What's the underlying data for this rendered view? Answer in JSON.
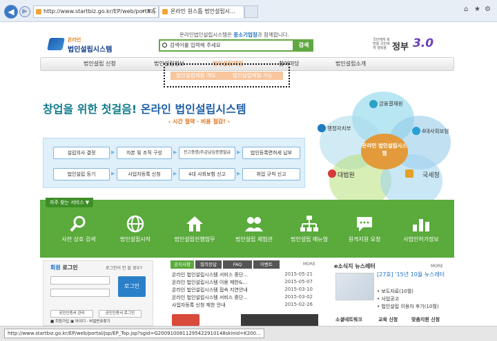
{
  "browser": {
    "address": "http://www.startbiz.go.kr/EP/web/portal/j",
    "tab_title": "온라인 원스톱 법인설립시...",
    "address_controls": "⌕ ▾ C"
  },
  "logo": {
    "line1": "온라인",
    "line2": "법인설립시스템"
  },
  "tagline": {
    "pre": "온라인법인설립시스템은 ",
    "org": "중소기업청",
    "post": "과 함께합니다."
  },
  "search": {
    "placeholder": "검색어를 입력해 주세요",
    "button": "검색"
  },
  "gov": {
    "small": "국민에게 희망을 국민에게 행복을",
    "name": "정부",
    "version": "3.0"
  },
  "gnb": [
    "법인설립 신청",
    "법인설립정보",
    "법인설립체험",
    "참여마당",
    "법인설립소개"
  ],
  "submenu": [
    "법인설립체험 개요",
    "법인설립체험 가능"
  ],
  "headline": {
    "part1": "창업을 위한 첫걸음! ",
    "part2": "온라인 법인설립시스템"
  },
  "subheadline": "- 시간 절약 · 비용 절감! -",
  "process": {
    "row1": [
      "설립의사 결정",
      "자본 및 조직 구성",
      "잔고증명/주금납입증명발급",
      "법인등록면허세 납부"
    ],
    "row2": [
      "법인설립 등기",
      "사업자등록 신청",
      "4대 사회보험 신고",
      "취업 규칙 신고"
    ]
  },
  "venn": {
    "center": "온라인 법인설립시스템",
    "labels": [
      "금융결제원",
      "행정자치부",
      "4대사회보험",
      "대법원",
      "국세청"
    ]
  },
  "services": {
    "title": "자주 찾는 서비스",
    "items": [
      "사전 상호 검색",
      "법인설립시작",
      "법인설립진행업무",
      "법인설립 체험관",
      "법인설립 매뉴얼",
      "원격지원 요청",
      "사업인허가정보"
    ]
  },
  "login": {
    "title_pre": "회원",
    "title_post": " 로그인",
    "question": "로그인이 안 될 경우?",
    "button": "로그인",
    "cert1": "공인인증서 관리",
    "cert2": "공인인증서 로그인",
    "links": "회원가입 ▣ 아이디 · 비밀번호찾기"
  },
  "notice": {
    "tabs": [
      "공지사항",
      "질의응답",
      "FAQ",
      "이벤트"
    ],
    "more": "MORE",
    "rows": [
      {
        "title": "온라인 법인설립시스템 서비스 중단...",
        "date": "2015-05-21"
      },
      {
        "title": "온라인 법인설립시스템 이용 제한&...",
        "date": "2015-05-07"
      },
      {
        "title": "온라인 법인설립시스템 접속 지연안내",
        "date": "2015-03-10"
      },
      {
        "title": "온라인 법인설립시스템 서비스 중단...",
        "date": "2015-03-02"
      },
      {
        "title": "사업자등록 신청 제한 안내",
        "date": "2015-02-26"
      }
    ]
  },
  "newsletter": {
    "title": "e소식지 뉴스레터",
    "more": "MORE",
    "headline": "[27호] '15년 10월 뉴스레터",
    "items": [
      "• 보도자료(10월)",
      "• 사업공고",
      "• 법인설립 이용자 후기(10월)"
    ]
  },
  "social": [
    "소셜네트워크",
    "교육 신청",
    "맞춤지원 신청"
  ],
  "status": "http://www.startbiz.go.kr/EP/web/portal/jsp/EP_Top.jsp?sgid=G2009100811295422910148skinid=K200..."
}
